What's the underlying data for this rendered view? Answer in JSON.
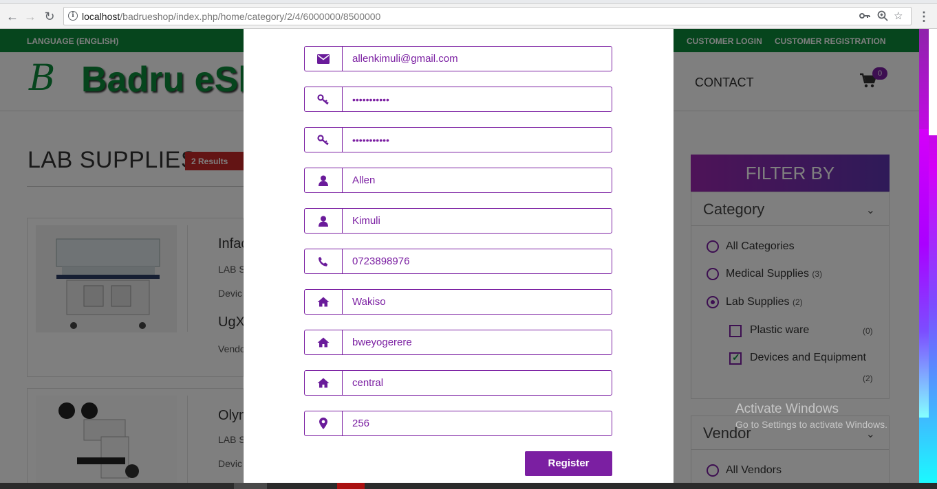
{
  "browser": {
    "url_host": "localhost",
    "url_path": "/badrueshop/index.php/home/category/2/4/6000000/8500000"
  },
  "topbar": {
    "language": "LANGUAGE (ENGLISH)",
    "customer_login": "CUSTOMER LOGIN",
    "customer_registration": "CUSTOMER REGISTRATION"
  },
  "header": {
    "logo_mark": "B",
    "logo_text": "Badru eSh",
    "contact": "CONTACT",
    "cart_count": "0"
  },
  "category": {
    "title": "LAB SUPPLIES",
    "results": "2 Results"
  },
  "products": [
    {
      "name": "Infac",
      "category": "LAB S",
      "subcategory": "Devic",
      "price": "UgX",
      "vendor": "Vendo"
    },
    {
      "name": "Olyn",
      "category": "LAB S",
      "subcategory": "Devic"
    }
  ],
  "filter": {
    "heading": "FILTER BY",
    "category_label": "Category",
    "options": [
      {
        "label": "All Categories",
        "count": ""
      },
      {
        "label": "Medical Supplies",
        "count": "(3)"
      },
      {
        "label": "Lab Supplies",
        "count": "(2)"
      }
    ],
    "sub_options": [
      {
        "label": "Plastic ware",
        "count": "(0)"
      },
      {
        "label": "Devices and Equipment",
        "count": "(2)"
      }
    ],
    "vendor_label": "Vendor",
    "vendor_all": "All Vendors"
  },
  "watermark": {
    "line1": "Activate Windows",
    "line2": "Go to Settings to activate Windows."
  },
  "form": {
    "email": "allenkimuli@gmail.com",
    "password": "•••••••••••",
    "confirm_password": "•••••••••••",
    "first_name": "Allen",
    "last_name": "Kimuli",
    "phone": "0723898976",
    "district": "Wakiso",
    "address": "bweyogerere",
    "region": "central",
    "country_code": "256",
    "register_label": "Register"
  },
  "colors": {
    "accent": "#7b1fa2",
    "brand_green": "#0d8a3a",
    "badge_red": "#c62828"
  }
}
